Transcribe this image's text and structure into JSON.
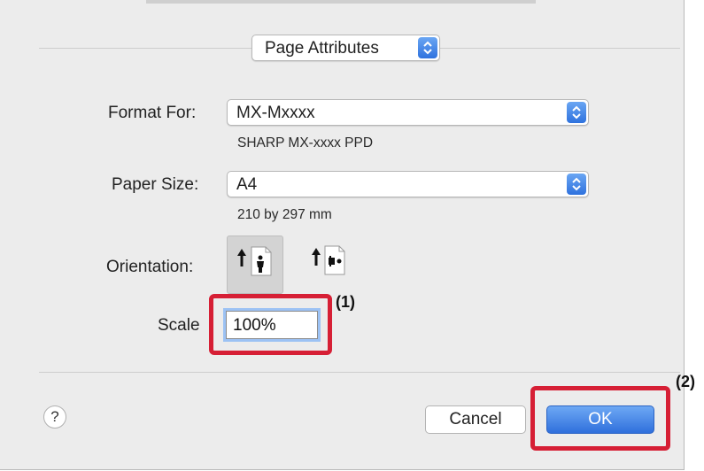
{
  "panel_selector": {
    "value": "Page Attributes"
  },
  "format_for": {
    "label": "Format For:",
    "value": "MX-Mxxxx",
    "description": "SHARP MX-xxxx PPD"
  },
  "paper_size": {
    "label": "Paper Size:",
    "value": "A4",
    "description": "210 by 297 mm"
  },
  "orientation": {
    "label": "Orientation:",
    "selected": "portrait",
    "options": [
      "portrait-icon",
      "landscape-icon"
    ]
  },
  "scale": {
    "label": "Scale",
    "value": "100%"
  },
  "callouts": {
    "one": "(1)",
    "two": "(2)"
  },
  "buttons": {
    "help": "?",
    "cancel": "Cancel",
    "ok": "OK"
  },
  "colors": {
    "accent": "#3b7be0",
    "highlight": "#d61f35",
    "background": "#ececec"
  }
}
